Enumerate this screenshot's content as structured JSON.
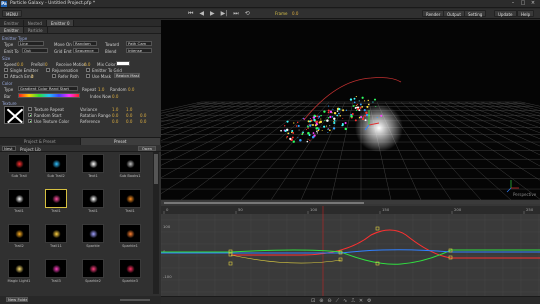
{
  "titlebar": {
    "app_icon": "Pa",
    "title": "Particle Galaxy - Untitled Project.pfp *"
  },
  "toolbar": {
    "menu": "MENU",
    "render": "Render",
    "output": "Output",
    "setting": "Setting",
    "update": "Update",
    "help": "Help",
    "frame": "Frame",
    "frame_value": "0.0"
  },
  "left_tabs": [
    "Emitter",
    "Nested",
    "Emitter 0"
  ],
  "sub_tabs": [
    "Emitter",
    "Particle"
  ],
  "emitter_type": {
    "header": "Emitter Type",
    "type_label": "Type",
    "type_value": "Line",
    "move_on_label": "Move On",
    "move_on_value": "Random",
    "toward_label": "Toward",
    "toward_value": "Path Cam",
    "emit_to_label": "Emit To",
    "emit_to_value": "Out",
    "grid_emit_label": "Grid Emt",
    "grid_emit_value": "Sequence",
    "blend_label": "Blend",
    "blend_value": "Intense"
  },
  "size": {
    "header": "Size",
    "speed_label": "Speed",
    "speed_value": "0.0",
    "preroll_label": "PreRoll",
    "preroll_value": "0",
    "receive_motion_label": "Receive Motion",
    "receive_motion_value": "0.0",
    "mix_color_label": "Mix Color",
    "single_emitter": "Single Emitter",
    "rejuvenation": "Rejuvenation",
    "emitter_to_grid": "Emitter To Grid",
    "attach_emit_label": "Attach Emit",
    "attach_emit_value": "0",
    "refer_path": "Refer Path",
    "use_mask": "Use Mask",
    "region_mask": "Region Mask"
  },
  "color": {
    "header": "Color",
    "type_label": "Type",
    "type_value": "Gradient Color Rand Start",
    "repeat_label": "Repeat",
    "repeat_value": "1.0",
    "random_label": "Random",
    "random_value": "0.0",
    "bar_label": "Bar",
    "index_label": "Index Now",
    "index_value": "0.0"
  },
  "texture": {
    "header": "Texture",
    "texture_repeat": "Texture Repeat",
    "random_start": "Random Start",
    "use_texture_color": "Use Texture Color",
    "variance_label": "Variance",
    "variance_value": "1.0",
    "variance_value2": "1.0",
    "rotation_label": "Rotation Range",
    "rotation_values": [
      "0.0",
      "0.0",
      "0.0"
    ],
    "reference_label": "Reference",
    "reference_values": [
      "0.0",
      "0.0",
      "0.0"
    ]
  },
  "preset_panel": {
    "tabs": [
      "Project & Preset",
      "Preset"
    ],
    "folder": "Nest",
    "project_lib": "Project Lib",
    "open": "Open",
    "new_folder": "New Folder",
    "items": [
      {
        "label": "Sub Trail",
        "glow": "#ff3030"
      },
      {
        "label": "Sub Trail2",
        "glow": "#30c0ff"
      },
      {
        "label": "Text1",
        "glow": "#ffffff"
      },
      {
        "label": "Sub Books1",
        "glow": "#c0c0c0"
      },
      {
        "label": "Trail1",
        "glow": "#ffffff"
      },
      {
        "label": "Trail1",
        "glow": "#ff50a0"
      },
      {
        "label": "Trail1",
        "glow": "#ffffff"
      },
      {
        "label": "Trail1",
        "glow": "#ff9020"
      },
      {
        "label": "Trail2",
        "glow": "#ffb020"
      },
      {
        "label": "Trail11",
        "glow": "#ffd040"
      },
      {
        "label": "Sparkle",
        "glow": "#a0a0ff"
      },
      {
        "label": "Sparkle1",
        "glow": "#ff8030"
      },
      {
        "label": "Magic Light1",
        "glow": "#ffe070"
      },
      {
        "label": "Trail3",
        "glow": "#ff40c0"
      },
      {
        "label": "Sparkle2",
        "glow": "#ff4080"
      },
      {
        "label": "Sparkle3",
        "glow": "#ff3060"
      }
    ]
  },
  "viewport": {
    "world_label": "Perspective"
  },
  "timeline": {
    "ruler": [
      "0",
      "50",
      "100",
      "150",
      "200",
      "250"
    ],
    "y_labels": [
      "100",
      "0",
      "-100"
    ]
  },
  "colors": {
    "accent": "#d6c040",
    "panel": "#333333",
    "viewport_bg": "#050505",
    "curve_red": "#ff3030",
    "curve_green": "#30e040",
    "curve_blue": "#3080ff",
    "curve_yellow": "#e0d040"
  }
}
